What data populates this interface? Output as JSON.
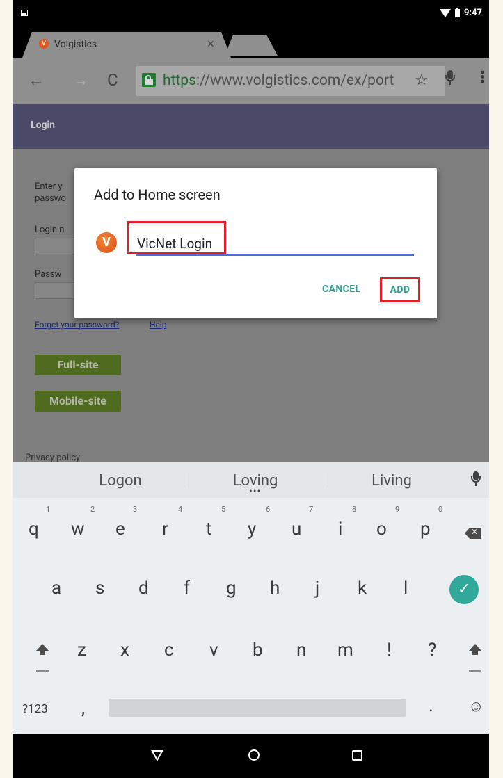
{
  "status_bar": {
    "time": "9:47"
  },
  "tabs": {
    "active_title": "Volgistics",
    "close_glyph": "×"
  },
  "url_bar": {
    "scheme": "https",
    "rest": "://www.volgistics.com/ex/port",
    "back_glyph": "←",
    "forward_glyph": "→",
    "reload_glyph": "C",
    "star_glyph": "☆",
    "menu_glyph": "⋮"
  },
  "page": {
    "header": "Login",
    "enter_line1": "Enter y",
    "enter_line2": "passwo",
    "login_label": "Login n",
    "password_label": "Passw",
    "forgot_link": "Forget your password?",
    "help_link": "Help",
    "full_site_button": "Full-site",
    "mobile_site_button": "Mobile-site",
    "privacy_text": "Privacy policy"
  },
  "dialog": {
    "title": "Add to Home screen",
    "app_icon_letter": "V",
    "name_value": "VicNet Login",
    "cancel_label": "CANCEL",
    "add_label": "ADD"
  },
  "keyboard": {
    "suggestions": [
      "Logon",
      "Loving",
      "Living"
    ],
    "row1": [
      "q",
      "w",
      "e",
      "r",
      "t",
      "y",
      "u",
      "i",
      "o",
      "p"
    ],
    "row1_hints": [
      "1",
      "2",
      "3",
      "4",
      "5",
      "6",
      "7",
      "8",
      "9",
      "0"
    ],
    "row2": [
      "a",
      "s",
      "d",
      "f",
      "g",
      "h",
      "j",
      "k",
      "l"
    ],
    "row3": [
      "z",
      "x",
      "c",
      "v",
      "b",
      "n",
      "m",
      "!",
      "?"
    ],
    "symbols_key": "?123",
    "comma_key": ",",
    "period_key": ".",
    "emoji_glyph": "☺",
    "enter_glyph": "✓",
    "more_dots": "•••"
  }
}
